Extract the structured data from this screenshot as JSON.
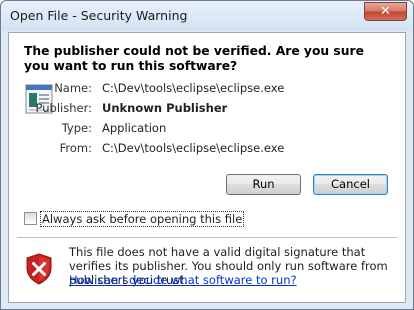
{
  "window": {
    "title": "Open File - Security Warning",
    "close_label": "✕"
  },
  "headline": "The publisher could not be verified.  Are you sure you want to run this software?",
  "details": [
    {
      "label": "Name:",
      "value": "C:\\Dev\\tools\\eclipse\\eclipse.exe",
      "bold": false
    },
    {
      "label": "Publisher:",
      "value": "Unknown Publisher",
      "bold": true
    },
    {
      "label": "Type:",
      "value": "Application",
      "bold": false
    },
    {
      "label": "From:",
      "value": "C:\\Dev\\tools\\eclipse\\eclipse.exe",
      "bold": false
    }
  ],
  "buttons": {
    "run": "Run",
    "cancel": "Cancel"
  },
  "checkbox": {
    "label": "Always ask before opening this file",
    "checked": false
  },
  "warning": {
    "text": "This file does not have a valid digital signature that verifies its publisher.  You should only run software from publishers you trust.",
    "link": "How can I decide what software to run?"
  },
  "colors": {
    "link": "#0033cc",
    "close": "#c24630",
    "shield": "#c8201f"
  },
  "icons": {
    "file": "executable-file-icon",
    "warning": "shield-error-icon",
    "close": "close-icon"
  }
}
